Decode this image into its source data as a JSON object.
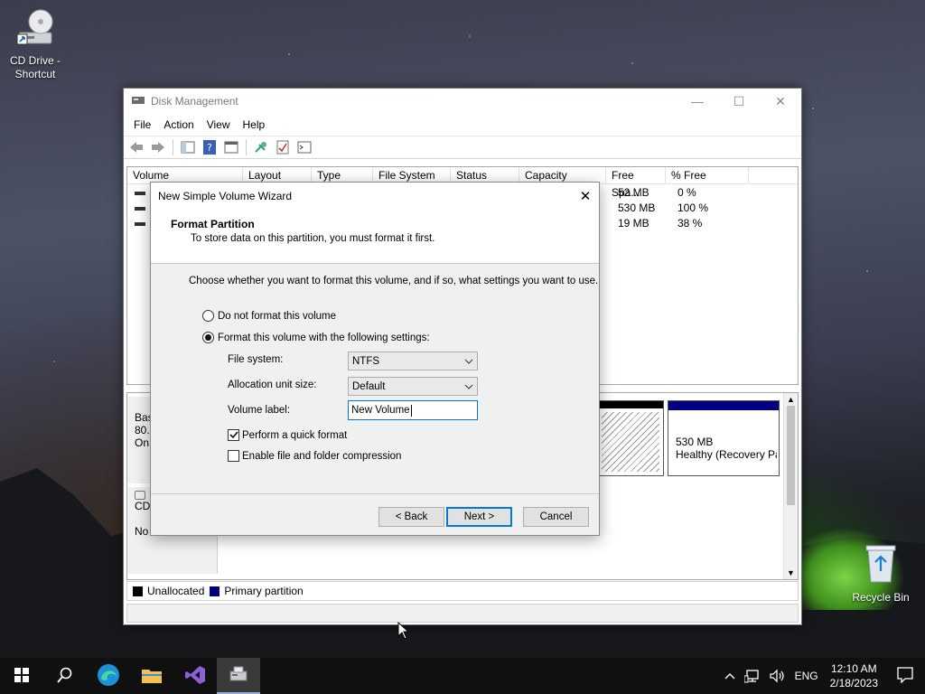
{
  "desktop": {
    "icons": [
      {
        "label": "CD Drive -\nShortcut",
        "icon": "cd-drive-shortcut-icon"
      },
      {
        "label": "Recycle Bin",
        "icon": "recycle-bin-icon"
      }
    ]
  },
  "window": {
    "title": "Disk Management",
    "menu": [
      "File",
      "Action",
      "View",
      "Help"
    ],
    "columns": [
      "Volume",
      "Layout",
      "Type",
      "File System",
      "Status",
      "Capacity",
      "Free Spa...",
      "% Free"
    ],
    "rows": [
      {
        "free": "52 MB",
        "pct": "0 %"
      },
      {
        "free": "530 MB",
        "pct": "100 %"
      },
      {
        "free": "19 MB",
        "pct": "38 %"
      }
    ],
    "partial_rows": [
      "(",
      "S"
    ],
    "disk0": {
      "label_lines": [
        "Bas",
        "80.",
        "On"
      ],
      "part_size": "530 MB",
      "part_status": "Healthy (Recovery Pa"
    },
    "cdrom": {
      "label": "CD",
      "media": "No Media"
    },
    "legend": {
      "unallocated": "Unallocated",
      "primary": "Primary partition"
    },
    "colors": {
      "unallocated": "#000000",
      "primary": "#000080"
    }
  },
  "wizard": {
    "title": "New Simple Volume Wizard",
    "heading": "Format Partition",
    "subheading": "To store data on this partition, you must format it first.",
    "intro": "Choose whether you want to format this volume, and if so, what settings you want to use.",
    "opt_no_format": "Do not format this volume",
    "opt_format": "Format this volume with the following settings:",
    "fs_label": "File system:",
    "fs_value": "NTFS",
    "alloc_label": "Allocation unit size:",
    "alloc_value": "Default",
    "vol_label": "Volume label:",
    "vol_value": "New Volume",
    "quick_format": "Perform a quick format",
    "compression": "Enable file and folder compression",
    "quick_checked": true,
    "compression_checked": false,
    "buttons": {
      "back": "< Back",
      "next": "Next >",
      "cancel": "Cancel"
    }
  },
  "taskbar": {
    "lang": "ENG",
    "time": "12:10 AM",
    "date": "2/18/2023"
  }
}
